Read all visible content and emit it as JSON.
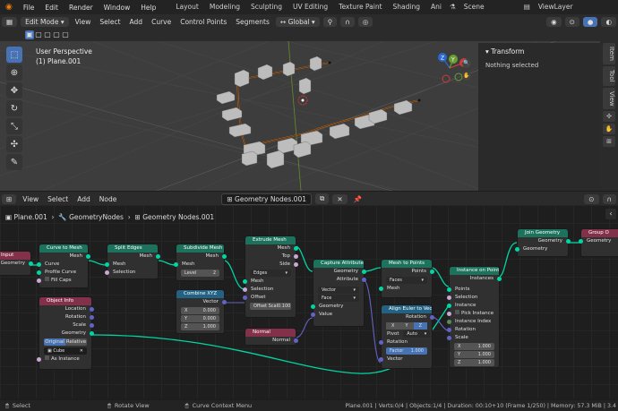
{
  "topbar": {
    "menus": [
      "File",
      "Edit",
      "Render",
      "Window",
      "Help"
    ],
    "workspaces": [
      "Layout",
      "Modeling",
      "Sculpting",
      "UV Editing",
      "Texture Paint",
      "Shading",
      "Ani"
    ],
    "scene": "Scene",
    "view_layer": "ViewLayer"
  },
  "viewport_header": {
    "mode": "Edit Mode",
    "menus": [
      "View",
      "Select",
      "Add",
      "Curve",
      "Control Points",
      "Segments"
    ],
    "transform_orientation": "Global"
  },
  "viewport": {
    "perspective": "User Perspective",
    "object": "(1) Plane.001",
    "axes": [
      "Z",
      "Y",
      "X"
    ],
    "panel_title": "Transform",
    "panel_text": "Nothing selected",
    "side_tabs": [
      "Item",
      "Tool",
      "View"
    ]
  },
  "node_header": {
    "menus": [
      "View",
      "Select",
      "Add",
      "Node"
    ],
    "tree_name": "Geometry Nodes.001"
  },
  "breadcrumb": [
    "Plane.001",
    "GeometryNodes",
    "Geometry Nodes.001"
  ],
  "nodes": {
    "group_input": {
      "title": "Input",
      "out_geometry": "Geometry"
    },
    "curve_to_mesh": {
      "title": "Curve to Mesh",
      "out": "Mesh",
      "in_curve": "Curve",
      "in_profile": "Profile Curve",
      "fill_caps": "Fill Caps"
    },
    "split_edges": {
      "title": "Split Edges",
      "out": "Mesh",
      "in_mesh": "Mesh",
      "in_selection": "Selection"
    },
    "subdivide": {
      "title": "Subdivide Mesh",
      "out": "Mesh",
      "in_mesh": "Mesh",
      "level_label": "Level",
      "level_value": "2"
    },
    "combine_xyz": {
      "title": "Combine XYZ",
      "out": "Vector",
      "x": "X",
      "x_val": "0.000",
      "y": "Y",
      "y_val": "0.000",
      "z": "Z",
      "z_val": "1.000"
    },
    "extrude": {
      "title": "Extrude Mesh",
      "out_mesh": "Mesh",
      "out_top": "Top",
      "out_side": "Side",
      "mode": "Edges",
      "in_mesh": "Mesh",
      "in_selection": "Selection",
      "in_offset": "Offset",
      "scale_label": "Offset Scal",
      "scale_value": "0.100"
    },
    "normal": {
      "title": "Normal",
      "out": "Normal"
    },
    "object_info": {
      "title": "Object Info",
      "location": "Location",
      "rotation": "Rotation",
      "scale": "Scale",
      "geometry": "Geometry",
      "original": "Original",
      "relative": "Relative",
      "object": "Cube",
      "as_instance": "As Instance"
    },
    "capture": {
      "title": "Capture Attribute",
      "out_geometry": "Geometry",
      "out_attribute": "Attribute",
      "type": "Vector",
      "domain": "Face",
      "in_geometry": "Geometry",
      "in_value": "Value"
    },
    "mesh_to_points": {
      "title": "Mesh to Points",
      "out": "Points",
      "mode": "Faces",
      "in_mesh": "Mesh"
    },
    "align_euler": {
      "title": "Align Euler to Vector",
      "out": "Rotation",
      "axis_x": "X",
      "axis_y": "Y",
      "axis_z": "Z",
      "pivot_label": "Pivot",
      "pivot_value": "Auto",
      "in_rotation": "Rotation",
      "factor_label": "Factor",
      "factor_value": "1.000",
      "in_vector": "Vector"
    },
    "instance_on_points": {
      "title": "Instance on Points",
      "out": "Instances",
      "points": "Points",
      "selection": "Selection",
      "instance": "Instance",
      "pick": "Pick Instance",
      "index": "Instance Index",
      "rotation": "Rotation",
      "scale": "Scale",
      "x": "X",
      "x_val": "1.000",
      "y": "Y",
      "y_val": "1.000",
      "z": "Z",
      "z_val": "1.000"
    },
    "join": {
      "title": "Join Geometry",
      "out": "Geometry",
      "in": "Geometry"
    },
    "group_output": {
      "title": "Group O",
      "in": "Geometry"
    }
  },
  "statusbar": {
    "select": "Select",
    "rotate": "Rotate View",
    "context": "Curve Context Menu",
    "stats": "Plane.001 | Verts:0/4 | Objects:1/4 | Duration: 00:10+10 (Frame 1/250) | Memory: 57.3 MiB | 3.4"
  },
  "colors": {
    "accent": "#4772b3",
    "geometry_header": "#1d725e",
    "input_header": "#83314a",
    "vector_header": "#246283",
    "link": "#00d6a3"
  }
}
